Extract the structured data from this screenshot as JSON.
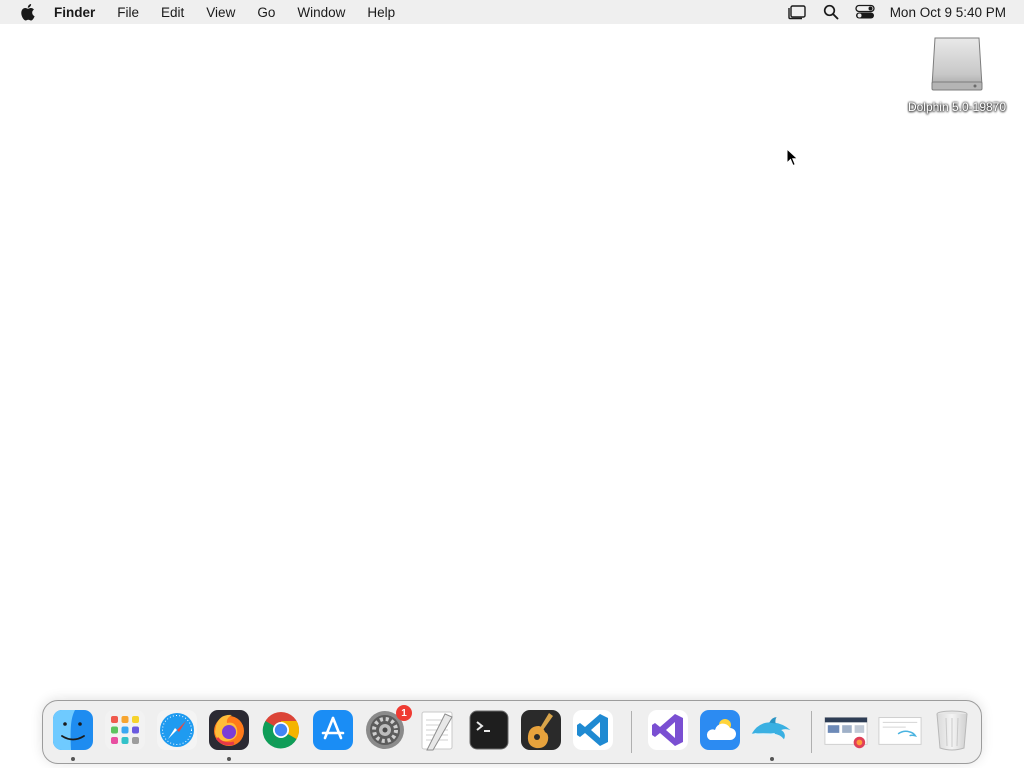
{
  "menubar": {
    "app_name": "Finder",
    "items": [
      "File",
      "Edit",
      "View",
      "Go",
      "Window",
      "Help"
    ],
    "clock": "Mon Oct 9  5:40 PM",
    "status_icons": [
      "stage-manager-icon",
      "spotlight-search-icon",
      "control-center-icon"
    ]
  },
  "desktop": {
    "drive": {
      "label": "Dolphin 5.0-19870",
      "icon": "disk-image-icon"
    }
  },
  "dock": {
    "apps": [
      {
        "name": "Finder",
        "icon": "finder-icon",
        "running": true
      },
      {
        "name": "Launchpad",
        "icon": "launchpad-icon",
        "running": false
      },
      {
        "name": "Safari",
        "icon": "safari-icon",
        "running": false
      },
      {
        "name": "Firefox",
        "icon": "firefox-icon",
        "running": true
      },
      {
        "name": "Google Chrome",
        "icon": "chrome-icon",
        "running": false
      },
      {
        "name": "App Store",
        "icon": "app-store-icon",
        "running": false
      },
      {
        "name": "System Settings",
        "icon": "system-settings-icon",
        "running": false,
        "badge": "1"
      },
      {
        "name": "TextEdit",
        "icon": "textedit-icon",
        "running": false
      },
      {
        "name": "Terminal",
        "icon": "terminal-icon",
        "running": false
      },
      {
        "name": "GarageBand",
        "icon": "garageband-icon",
        "running": false
      },
      {
        "name": "Visual Studio Code",
        "icon": "vscode-icon",
        "running": false
      },
      {
        "name": "Visual Studio",
        "icon": "visual-studio-icon",
        "running": false
      },
      {
        "name": "Weather",
        "icon": "weather-icon",
        "running": false
      },
      {
        "name": "Dolphin",
        "icon": "dolphin-icon",
        "running": true
      }
    ],
    "stacks": [
      {
        "name": "Downloads",
        "icon": "downloads-stack-icon"
      },
      {
        "name": "Documents",
        "icon": "documents-stack-icon"
      }
    ],
    "trash": {
      "name": "Trash",
      "icon": "trash-icon"
    }
  },
  "colors": {
    "menubar_bg": "#efefef",
    "desktop_bg": "#ffffff",
    "badge": "#ef3b33"
  }
}
